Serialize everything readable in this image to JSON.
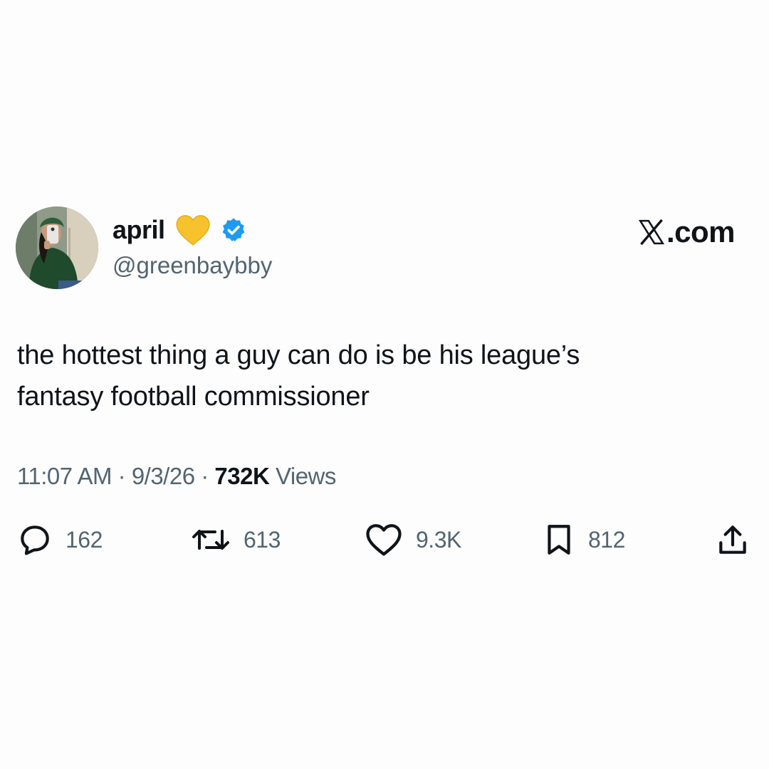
{
  "user": {
    "display_name": "april",
    "handle": "@greenbaybby",
    "heart_color": "#f7c22b",
    "verified_color": "#1d9bf0"
  },
  "brand": {
    "label": ".com",
    "icon": "x-logo-icon"
  },
  "tweet": {
    "line1": "the hottest thing a guy can do is be his league’s",
    "line2": "fantasy football commissioner"
  },
  "meta": {
    "time": "11:07 AM",
    "sep1": " · ",
    "date": "9/3/26",
    "sep2": " · ",
    "views_count": "732K",
    "views_label": " Views"
  },
  "actions": {
    "replies": "162",
    "reposts": "613",
    "likes": "9.3K",
    "bookmarks": "812"
  },
  "colors": {
    "text": "#0f1419",
    "secondary": "#536471",
    "background": "#fdfdfd"
  }
}
